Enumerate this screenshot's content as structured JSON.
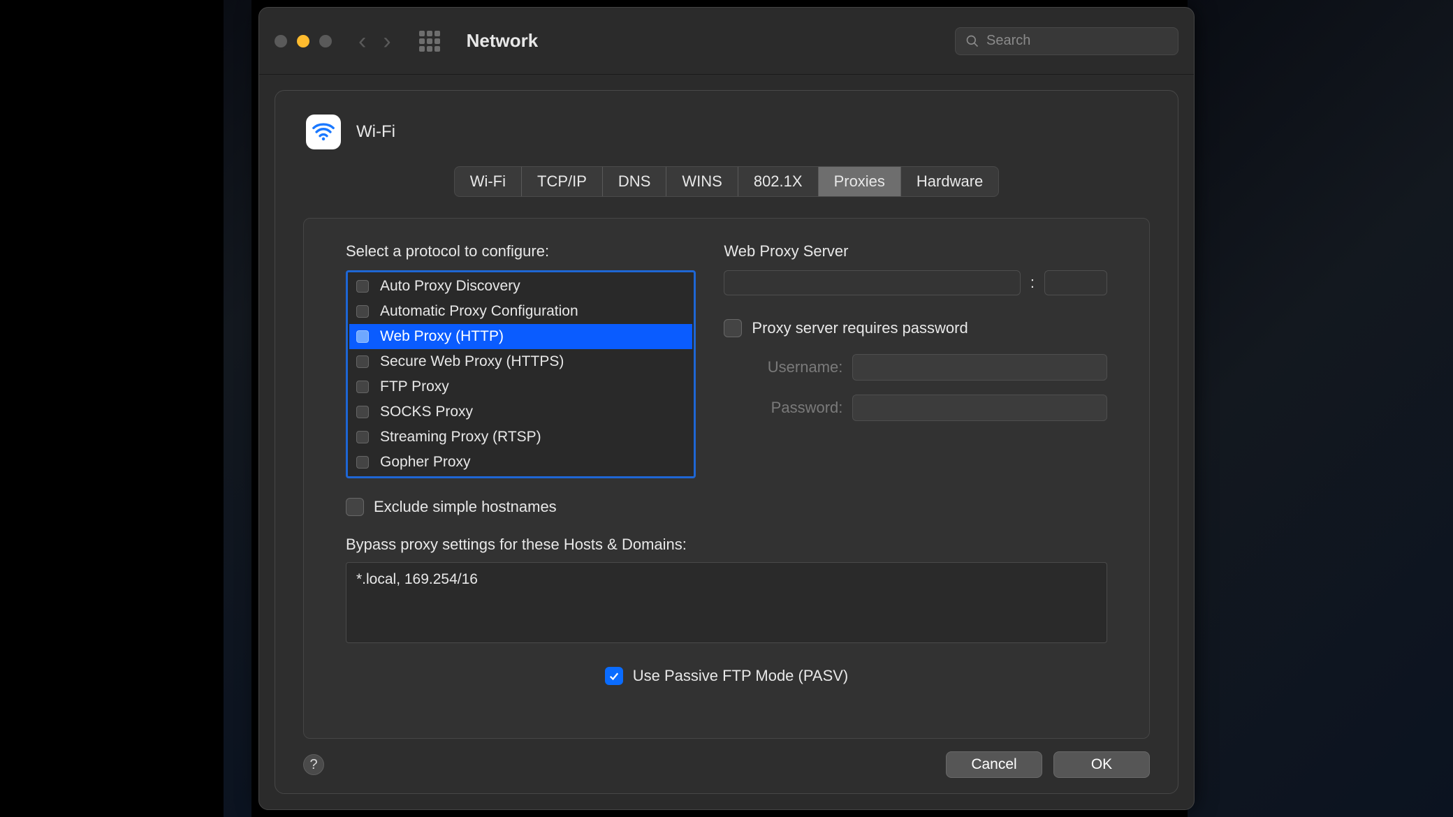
{
  "window": {
    "title": "Network",
    "search_placeholder": "Search"
  },
  "interface": {
    "name": "Wi-Fi"
  },
  "tabs": [
    {
      "label": "Wi-Fi",
      "active": false
    },
    {
      "label": "TCP/IP",
      "active": false
    },
    {
      "label": "DNS",
      "active": false
    },
    {
      "label": "WINS",
      "active": false
    },
    {
      "label": "802.1X",
      "active": false
    },
    {
      "label": "Proxies",
      "active": true
    },
    {
      "label": "Hardware",
      "active": false
    }
  ],
  "protocol_section": {
    "label": "Select a protocol to configure:",
    "items": [
      {
        "label": "Auto Proxy Discovery",
        "checked": false,
        "selected": false
      },
      {
        "label": "Automatic Proxy Configuration",
        "checked": false,
        "selected": false
      },
      {
        "label": "Web Proxy (HTTP)",
        "checked": false,
        "selected": true
      },
      {
        "label": "Secure Web Proxy (HTTPS)",
        "checked": false,
        "selected": false
      },
      {
        "label": "FTP Proxy",
        "checked": false,
        "selected": false
      },
      {
        "label": "SOCKS Proxy",
        "checked": false,
        "selected": false
      },
      {
        "label": "Streaming Proxy (RTSP)",
        "checked": false,
        "selected": false
      },
      {
        "label": "Gopher Proxy",
        "checked": false,
        "selected": false
      }
    ]
  },
  "server_section": {
    "label": "Web Proxy Server",
    "host_value": "",
    "port_value": "",
    "separator": ":",
    "requires_password_label": "Proxy server requires password",
    "requires_password_checked": false,
    "username_label": "Username:",
    "username_value": "",
    "password_label": "Password:",
    "password_value": ""
  },
  "exclude_simple": {
    "label": "Exclude simple hostnames",
    "checked": false
  },
  "bypass": {
    "label": "Bypass proxy settings for these Hosts & Domains:",
    "value": "*.local, 169.254/16"
  },
  "pasv": {
    "label": "Use Passive FTP Mode (PASV)",
    "checked": true
  },
  "buttons": {
    "help": "?",
    "cancel": "Cancel",
    "ok": "OK"
  }
}
